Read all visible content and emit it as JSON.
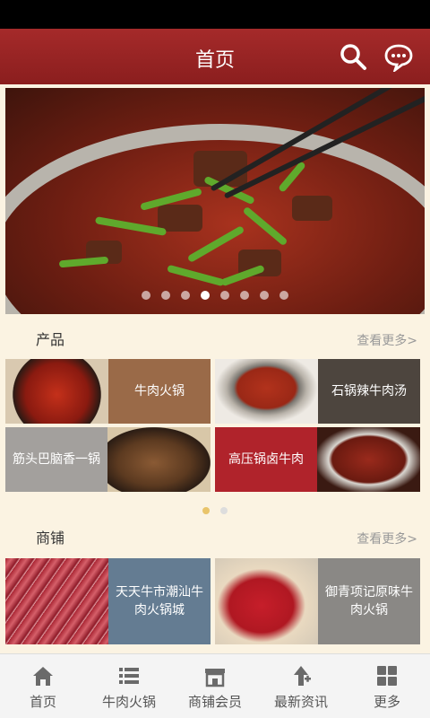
{
  "header": {
    "title": "首页"
  },
  "banner": {
    "slide_count": 8,
    "active_slide": 3
  },
  "products": {
    "title": "产品",
    "more": "查看更多>",
    "items": [
      {
        "label": "牛肉火锅",
        "color": "#9a6a48"
      },
      {
        "label": "石锅辣牛肉汤",
        "color": "#4d453e"
      },
      {
        "label": "筋头巴脑香一锅",
        "color": "#a3a09d"
      },
      {
        "label": "高压锅卤牛肉",
        "color": "#b0232b"
      }
    ]
  },
  "products_pager": {
    "pages": 2,
    "active": 1
  },
  "shops": {
    "title": "商铺",
    "more": "查看更多>",
    "items": [
      {
        "label": "天天牛市潮汕牛肉火锅城",
        "color": "#647c92"
      },
      {
        "label": "御青项记原味牛肉火锅",
        "color": "#8a8885"
      }
    ]
  },
  "tabbar": {
    "items": [
      {
        "label": "首页",
        "icon": "home-icon"
      },
      {
        "label": "牛肉火锅",
        "icon": "list-icon"
      },
      {
        "label": "商铺会员",
        "icon": "store-icon"
      },
      {
        "label": "最新资讯",
        "icon": "news-icon"
      },
      {
        "label": "更多",
        "icon": "grid-icon"
      }
    ]
  }
}
